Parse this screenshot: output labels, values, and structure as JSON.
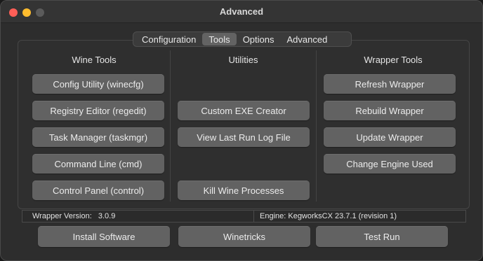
{
  "window": {
    "title": "Advanced"
  },
  "tabs": [
    {
      "label": "Configuration",
      "active": false
    },
    {
      "label": "Tools",
      "active": true
    },
    {
      "label": "Options",
      "active": false
    },
    {
      "label": "Advanced",
      "active": false
    }
  ],
  "wine_tools": {
    "header": "Wine Tools",
    "buttons": [
      "Config Utility (winecfg)",
      "Registry Editor (regedit)",
      "Task Manager (taskmgr)",
      "Command Line (cmd)",
      "Control Panel (control)"
    ]
  },
  "utilities": {
    "header": "Utilities",
    "buttons": [
      "Custom EXE Creator",
      "View Last Run Log File",
      "Kill Wine Processes"
    ]
  },
  "wrapper_tools": {
    "header": "Wrapper Tools",
    "buttons": [
      "Refresh Wrapper",
      "Rebuild Wrapper",
      "Update Wrapper",
      "Change Engine Used"
    ]
  },
  "status": {
    "wrapper_version_label": "Wrapper Version:",
    "wrapper_version_value": "3.0.9",
    "engine_text": "Engine: KegworksCX 23.7.1 (revision 1)"
  },
  "bottom_buttons": {
    "install": "Install Software",
    "winetricks": "Winetricks",
    "test_run": "Test Run"
  },
  "colors": {
    "window_bg": "#2d2d2d",
    "button_bg": "#626262",
    "active_tab_bg": "#636363",
    "close": "#ff5f57",
    "minimize": "#febc2e",
    "zoom_disabled": "#5b5b5b"
  }
}
